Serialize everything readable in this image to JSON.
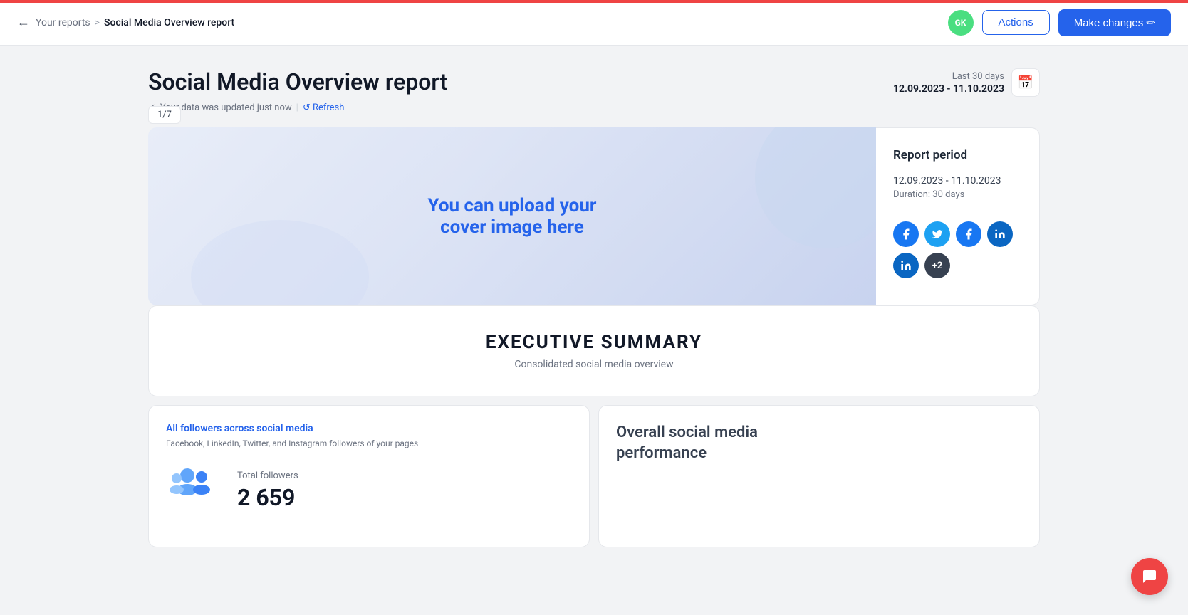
{
  "redbar": true,
  "nav": {
    "back_label": "←",
    "breadcrumb_parent": "Your reports",
    "breadcrumb_sep": ">",
    "breadcrumb_current": "Social Media Overview report",
    "avatar_initials": "GK",
    "actions_label": "Actions",
    "make_changes_label": "Make changes ✏"
  },
  "report": {
    "title": "Social Media Overview report",
    "data_status": "Your data was updated just now",
    "separator": "|",
    "refresh_label": "↺ Refresh",
    "date_range_label": "Last 30 days",
    "date_range_value": "12.09.2023 - 11.10.2023",
    "calendar_icon": "📅"
  },
  "slide": {
    "indicator": "1/7"
  },
  "cover": {
    "line1": "You can upload your",
    "link": "cover image",
    "line2": "here"
  },
  "period_card": {
    "title": "Report period",
    "dates": "12.09.2023 - 11.10.2023",
    "duration": "Duration: 30 days"
  },
  "social_icons": [
    {
      "name": "facebook",
      "label": "f",
      "class": "facebook"
    },
    {
      "name": "twitter",
      "label": "t",
      "class": "twitter"
    },
    {
      "name": "facebook2",
      "label": "f",
      "class": "facebook2"
    },
    {
      "name": "linkedin",
      "label": "in",
      "class": "linkedin"
    },
    {
      "name": "linkedin2",
      "label": "in",
      "class": "linkedin2"
    },
    {
      "name": "more",
      "label": "+2",
      "class": "more"
    }
  ],
  "executive": {
    "title": "EXECUTIVE SUMMARY",
    "subtitle": "Consolidated social media overview"
  },
  "followers_card": {
    "title": "All followers across social media",
    "description": "Facebook, LinkedIn, Twitter, and Instagram followers of your pages",
    "total_label": "Total followers",
    "total_count": "2 659",
    "icon": "👥"
  },
  "overall_card": {
    "title": "Overall social media\nperformance"
  },
  "chat": {
    "icon": "💬"
  }
}
